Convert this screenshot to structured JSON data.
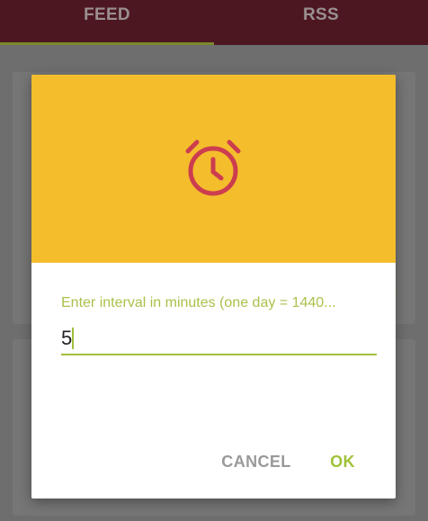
{
  "tabs": [
    {
      "label": "FEED"
    },
    {
      "label": "RSS"
    }
  ],
  "dialog": {
    "header_icon": "alarm-clock-icon",
    "prompt": "Enter interval in minutes (one day = 1440...",
    "input_value": "5",
    "cancel_label": "CANCEL",
    "ok_label": "OK"
  },
  "colors": {
    "appbar": "#4d1722",
    "dialog_header": "#f4bd2c",
    "icon": "#cc3d4f",
    "accent": "#9fc13a"
  }
}
